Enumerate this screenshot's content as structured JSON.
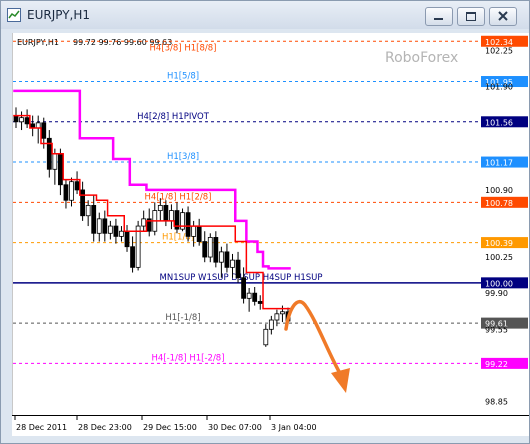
{
  "window": {
    "title": "EURJPY,H1",
    "minimize_icon": "minimize-icon",
    "maximize_icon": "maximize-icon",
    "close_icon": "close-icon"
  },
  "chart_header": {
    "symbol": "EURJPY,H1",
    "ohlc": "99.72 99.76 99.60 99.63"
  },
  "watermark": "RoboForex",
  "chart_data": {
    "type": "candlestick",
    "yaxis_ticks": [
      "102.34",
      "102.25",
      "101.95",
      "101.90",
      "101.56",
      "101.17",
      "100.90",
      "100.78",
      "100.39",
      "100.25",
      "100.00",
      "99.90",
      "99.61",
      "99.55",
      "99.22",
      "98.85"
    ],
    "x_tick_labels": [
      "28 Dec 2011",
      "28 Dec 23:00",
      "29 Dec 15:00",
      "30 Dec 07:00",
      "3 Jan 04:00"
    ],
    "levels": [
      {
        "label": "H4[3/8] H1[8/8]",
        "value": 102.34,
        "color": "#ff4a00",
        "style": "dashed",
        "badge": "102.34"
      },
      {
        "label": "H1[5/8]",
        "value": 101.95,
        "color": "#1e90ff",
        "style": "dashed",
        "badge": "101.95"
      },
      {
        "label": "H4[2/8] H1PIVOT",
        "value": 101.56,
        "color": "#000080",
        "style": "dashed",
        "badge": "101.56"
      },
      {
        "label": "H1[3/8]",
        "value": 101.17,
        "color": "#1e90ff",
        "style": "dashed",
        "badge": "101.17"
      },
      {
        "label": "H4[1/8] H1[2/8]",
        "value": 100.78,
        "color": "#ff4a00",
        "style": "dashed",
        "badge": "100.78"
      },
      {
        "label": "H1[1/8]",
        "value": 100.39,
        "color": "#ff9900",
        "style": "dashed",
        "badge": "100.39"
      },
      {
        "label": "MN1SUP W1SUP D1SUP H4SUP H1SUP",
        "value": 100.0,
        "color": "#000080",
        "style": "solid",
        "badge": "100.00"
      },
      {
        "label": "H1[-1/8]",
        "value": 99.61,
        "color": "#555555",
        "style": "dashed",
        "badge": "99.61"
      },
      {
        "label": "H4[-1/8] H1[-2/8]",
        "value": 99.22,
        "color": "#ff00ff",
        "style": "dashed",
        "badge": "99.22"
      }
    ],
    "plain_ticks": [
      "102.25",
      "101.90",
      "100.90",
      "100.25",
      "99.90",
      "99.55",
      "98.85"
    ],
    "ylim": [
      98.72,
      102.42
    ],
    "candles": [
      [
        101.62,
        101.7,
        101.5,
        101.56
      ],
      [
        101.56,
        101.66,
        101.48,
        101.6
      ],
      [
        101.6,
        101.68,
        101.5,
        101.54
      ],
      [
        101.54,
        101.62,
        101.42,
        101.5
      ],
      [
        101.5,
        101.62,
        101.35,
        101.55
      ],
      [
        101.55,
        101.6,
        101.3,
        101.4
      ],
      [
        101.4,
        101.48,
        101.02,
        101.1
      ],
      [
        101.1,
        101.3,
        100.95,
        101.25
      ],
      [
        101.25,
        101.3,
        100.85,
        100.95
      ],
      [
        100.95,
        101.0,
        100.72,
        100.8
      ],
      [
        100.8,
        101.02,
        100.74,
        100.98
      ],
      [
        100.98,
        101.08,
        100.86,
        100.9
      ],
      [
        100.9,
        100.98,
        100.6,
        100.65
      ],
      [
        100.65,
        100.8,
        100.55,
        100.75
      ],
      [
        100.75,
        100.85,
        100.4,
        100.48
      ],
      [
        100.48,
        100.68,
        100.4,
        100.62
      ],
      [
        100.62,
        100.7,
        100.4,
        100.48
      ],
      [
        100.48,
        100.6,
        100.42,
        100.55
      ],
      [
        100.55,
        100.62,
        100.38,
        100.45
      ],
      [
        100.45,
        100.55,
        100.4,
        100.5
      ],
      [
        100.5,
        100.56,
        100.3,
        100.35
      ],
      [
        100.35,
        100.45,
        100.1,
        100.15
      ],
      [
        100.15,
        100.6,
        100.12,
        100.55
      ],
      [
        100.55,
        100.7,
        100.5,
        100.62
      ],
      [
        100.62,
        100.72,
        100.45,
        100.5
      ],
      [
        100.5,
        100.78,
        100.46,
        100.7
      ],
      [
        100.7,
        100.82,
        100.6,
        100.75
      ],
      [
        100.75,
        100.8,
        100.55,
        100.6
      ],
      [
        100.6,
        100.76,
        100.52,
        100.7
      ],
      [
        100.7,
        100.78,
        100.48,
        100.52
      ],
      [
        100.52,
        100.72,
        100.5,
        100.68
      ],
      [
        100.68,
        100.74,
        100.4,
        100.45
      ],
      [
        100.45,
        100.6,
        100.35,
        100.55
      ],
      [
        100.55,
        100.62,
        100.36,
        100.4
      ],
      [
        100.4,
        100.5,
        100.2,
        100.25
      ],
      [
        100.25,
        100.48,
        100.2,
        100.44
      ],
      [
        100.44,
        100.5,
        100.15,
        100.2
      ],
      [
        100.2,
        100.35,
        100.05,
        100.3
      ],
      [
        100.3,
        100.38,
        100.1,
        100.15
      ],
      [
        100.15,
        100.28,
        100.05,
        100.22
      ],
      [
        100.22,
        100.3,
        100.0,
        100.05
      ],
      [
        100.05,
        100.15,
        99.8,
        99.85
      ],
      [
        99.85,
        99.95,
        99.72,
        99.9
      ],
      [
        99.9,
        99.96,
        99.78,
        99.82
      ],
      [
        99.82,
        99.88,
        99.74,
        99.8
      ],
      [
        99.4,
        99.6,
        99.38,
        99.55
      ],
      [
        99.55,
        99.68,
        99.5,
        99.64
      ],
      [
        99.64,
        99.74,
        99.58,
        99.7
      ],
      [
        99.7,
        99.78,
        99.62,
        99.72
      ],
      [
        99.72,
        99.76,
        99.6,
        99.63
      ]
    ],
    "red_line": [
      101.62,
      101.62,
      101.62,
      101.5,
      101.5,
      101.35,
      101.35,
      101.25,
      101.25,
      101.0,
      101.0,
      101.0,
      100.85,
      100.85,
      100.85,
      100.8,
      100.8,
      100.65,
      100.65,
      100.65,
      100.5,
      100.5,
      100.5,
      100.5,
      100.6,
      100.6,
      100.6,
      100.6,
      100.6,
      100.55,
      100.55,
      100.55,
      100.55,
      100.55,
      100.55,
      100.55,
      100.55,
      100.55,
      100.55,
      100.55,
      100.4,
      100.4,
      100.1,
      100.1,
      100.1,
      99.75,
      99.75,
      99.75,
      99.75,
      99.75
    ],
    "magenta_line": [
      101.86,
      101.86,
      101.86,
      101.86,
      101.86,
      101.86,
      101.86,
      101.86,
      101.86,
      101.86,
      101.86,
      101.86,
      101.4,
      101.4,
      101.4,
      101.4,
      101.4,
      101.4,
      101.2,
      101.2,
      101.2,
      100.95,
      100.95,
      100.95,
      100.9,
      100.9,
      100.9,
      100.9,
      100.9,
      100.9,
      100.9,
      100.9,
      100.9,
      100.9,
      100.9,
      100.9,
      100.9,
      100.9,
      100.9,
      100.9,
      100.6,
      100.6,
      100.4,
      100.4,
      100.3,
      100.16,
      100.14,
      100.14,
      100.14,
      100.14
    ],
    "arrow_color": "#f07a28"
  }
}
